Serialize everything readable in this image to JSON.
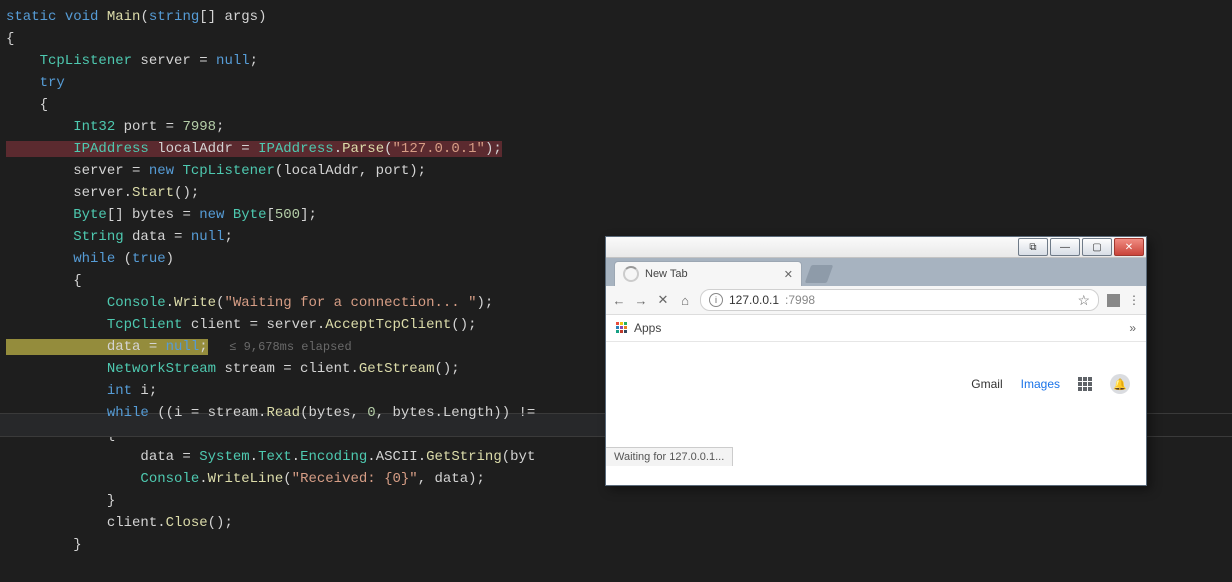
{
  "code": {
    "l1a": "static ",
    "l1b": "void ",
    "l1c": "Main",
    "l1d": "(",
    "l1e": "string",
    "l1f": "[] args)",
    "l2": "{",
    "l3a": "    TcpListener ",
    "l3b": "server = ",
    "l3c": "null",
    "l3d": ";",
    "l4a": "    try",
    "l5": "    {",
    "l6a": "        Int32 ",
    "l6b": "port = ",
    "l6c": "7998",
    "l6d": ";",
    "l7a": "        IPAddress ",
    "l7b": "localAddr = ",
    "l7c": "IPAddress",
    "l7d": ".",
    "l7e": "Parse",
    "l7f": "(",
    "l7g": "\"127.0.0.1\"",
    "l7h": ");",
    "l8a": "        server = ",
    "l8b": "new ",
    "l8c": "TcpListener",
    "l8d": "(localAddr, port);",
    "l9a": "        server.",
    "l9b": "Start",
    "l9c": "();",
    "l10a": "        Byte",
    "l10b": "[] bytes = ",
    "l10c": "new ",
    "l10d": "Byte",
    "l10e": "[",
    "l10f": "500",
    "l10g": "];",
    "l11a": "        String ",
    "l11b": "data = ",
    "l11c": "null",
    "l11d": ";",
    "l12a": "        while ",
    "l12b": "(",
    "l12c": "true",
    "l12d": ")",
    "l13": "        {",
    "l14a": "            Console",
    "l14b": ".",
    "l14c": "Write",
    "l14d": "(",
    "l14e": "\"Waiting for a connection... \"",
    "l14f": ");",
    "l15a": "            TcpClient ",
    "l15b": "client = server.",
    "l15c": "AcceptTcpClient",
    "l15d": "();",
    "l16a": "            data = ",
    "l16b": "null",
    "l16c": ";",
    "l16hint": "   ≤ 9,678ms elapsed",
    "l17a": "            NetworkStream ",
    "l17b": "stream = client.",
    "l17c": "GetStream",
    "l17d": "();",
    "l18a": "            int ",
    "l18b": "i;",
    "l19a": "            while ",
    "l19b": "((i = stream.",
    "l19c": "Read",
    "l19d": "(bytes, ",
    "l19e": "0",
    "l19f": ", bytes.Length)) !=",
    "l20": "            {",
    "l21a": "                data = ",
    "l21b": "System",
    "l21c": ".",
    "l21d": "Text",
    "l21e": ".",
    "l21f": "Encoding",
    "l21g": ".ASCII.",
    "l21h": "GetString",
    "l21i": "(byt",
    "l22a": "                Console",
    "l22b": ".",
    "l22c": "WriteLine",
    "l22d": "(",
    "l22e": "\"Received: {0}\"",
    "l22f": ", data);",
    "l23": "            }",
    "l24a": "            client.",
    "l24b": "Close",
    "l24c": "();",
    "l25": "        }"
  },
  "browser": {
    "tab_title": "New Tab",
    "url": "127.0.0.1",
    "port": ":7998",
    "apps_label": "Apps",
    "gmail": "Gmail",
    "images": "Images",
    "status": "Waiting for 127.0.0.1..."
  }
}
